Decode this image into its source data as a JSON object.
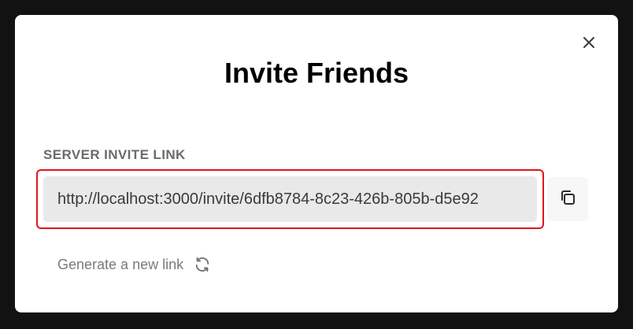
{
  "modal": {
    "title": "Invite Friends",
    "close_icon": "close-icon"
  },
  "invite": {
    "label": "SERVER INVITE LINK",
    "link_value": "http://localhost:3000/invite/6dfb8784-8c23-426b-805b-d5e92",
    "copy_icon": "copy-icon",
    "regenerate_label": "Generate a new link",
    "regenerate_icon": "refresh-icon"
  },
  "colors": {
    "backdrop": "#121212",
    "highlight_border": "#e0151d",
    "input_background": "#e9e9e9",
    "label_text": "#6b6b6b"
  }
}
